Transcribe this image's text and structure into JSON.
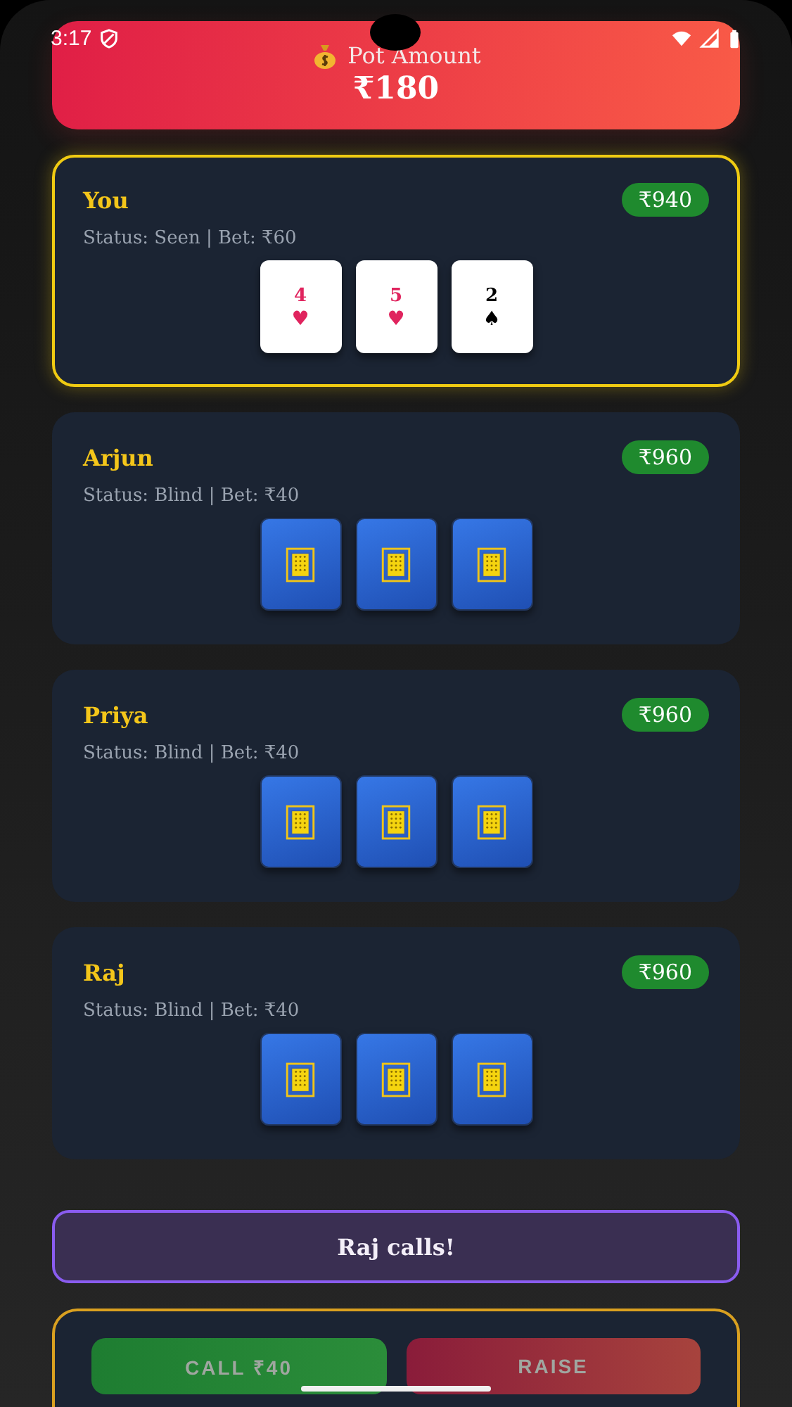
{
  "status_bar": {
    "time": "3:17"
  },
  "pot": {
    "label": "Pot Amount",
    "amount": "₹180"
  },
  "players": [
    {
      "name": "You",
      "chips": "₹940",
      "status": "Status: Seen | Bet: ₹60",
      "selected": true,
      "cards": [
        {
          "kind": "face",
          "rank": "4",
          "suit": "♥",
          "color": "#e0245e"
        },
        {
          "kind": "face",
          "rank": "5",
          "suit": "♥",
          "color": "#e0245e"
        },
        {
          "kind": "face",
          "rank": "2",
          "suit": "♠",
          "color": "#000000"
        }
      ]
    },
    {
      "name": "Arjun",
      "chips": "₹960",
      "status": "Status: Blind | Bet: ₹40",
      "selected": false,
      "cards": [
        {
          "kind": "back"
        },
        {
          "kind": "back"
        },
        {
          "kind": "back"
        }
      ]
    },
    {
      "name": "Priya",
      "chips": "₹960",
      "status": "Status: Blind | Bet: ₹40",
      "selected": false,
      "cards": [
        {
          "kind": "back"
        },
        {
          "kind": "back"
        },
        {
          "kind": "back"
        }
      ]
    },
    {
      "name": "Raj",
      "chips": "₹960",
      "status": "Status: Blind | Bet: ₹40",
      "selected": false,
      "cards": [
        {
          "kind": "back"
        },
        {
          "kind": "back"
        },
        {
          "kind": "back"
        }
      ]
    }
  ],
  "message": "Raj calls!",
  "actions": [
    {
      "label": "CALL ₹40",
      "kind": "call",
      "disabled": true
    },
    {
      "label": "RAISE",
      "kind": "raise",
      "disabled": true
    }
  ]
}
